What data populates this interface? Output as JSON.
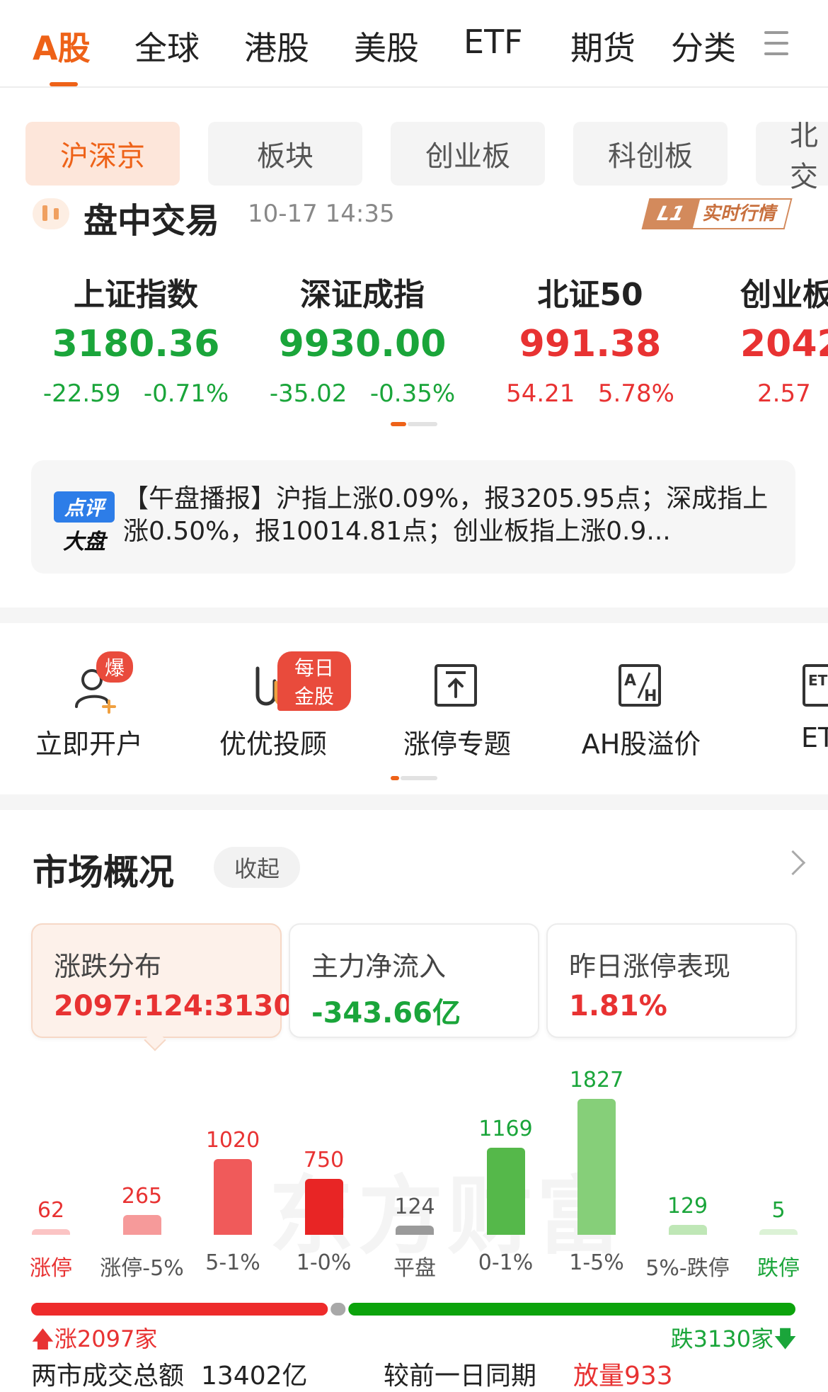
{
  "top_tabs": [
    "A股",
    "全球",
    "港股",
    "美股",
    "ETF",
    "期货",
    "分类"
  ],
  "sub_tabs": [
    "沪深京",
    "板块",
    "创业板",
    "科创板",
    "北交"
  ],
  "trade": {
    "title": "盘中交易",
    "time": "10-17 14:35",
    "badge_left": "L1",
    "badge_right": "实时行情"
  },
  "indices": [
    {
      "name": "上证指数",
      "value": "3180.36",
      "change": "-22.59",
      "pct": "-0.71%",
      "trend": "down"
    },
    {
      "name": "深证成指",
      "value": "9930.00",
      "change": "-35.02",
      "pct": "-0.35%",
      "trend": "down"
    },
    {
      "name": "北证50",
      "value": "991.38",
      "change": "54.21",
      "pct": "5.78%",
      "trend": "up"
    },
    {
      "name": "创业板",
      "value": "2042",
      "change": "2.57",
      "pct": "",
      "trend": "up"
    }
  ],
  "news": {
    "logo_top": "点评",
    "logo_bottom": "大盘",
    "text": "【午盘播报】沪指上涨0.09%，报3205.95点；深成指上涨0.50%，报10014.81点；创业板指上涨0.9..."
  },
  "shortcuts": [
    {
      "label": "立即开户",
      "badge": "爆"
    },
    {
      "label": "优优投顾",
      "badge": "每日金股"
    },
    {
      "label": "涨停专题",
      "badge": ""
    },
    {
      "label": "AH股溢价",
      "badge": ""
    },
    {
      "label": "ET",
      "badge": ""
    }
  ],
  "market": {
    "title": "市场概况",
    "collapse": "收起",
    "cards": [
      {
        "title": "涨跌分布",
        "value": "2097:124:3130",
        "color": "#e83232"
      },
      {
        "title": "主力净流入",
        "value": "-343.66亿",
        "color": "#1aa53a"
      },
      {
        "title": "昨日涨停表现",
        "value": "1.81%",
        "color": "#e83232"
      }
    ],
    "watermark": "东方财富"
  },
  "chart_data": {
    "type": "bar",
    "categories": [
      "涨停",
      "涨停-5%",
      "5-1%",
      "1-0%",
      "平盘",
      "0-1%",
      "1-5%",
      "5%-跌停",
      "跌停"
    ],
    "values": [
      62,
      265,
      1020,
      750,
      124,
      1169,
      1827,
      129,
      5
    ],
    "colors": [
      "#fbc4c4",
      "#f69a9a",
      "#f05a5a",
      "#e82525",
      "#9a9a9a",
      "#55b84a",
      "#86cf79",
      "#bfe7b6",
      "#dcf2d6"
    ],
    "label_colors": [
      "#e83232",
      "#e83232",
      "#e83232",
      "#e83232",
      "#555555",
      "#1aa53a",
      "#1aa53a",
      "#1aa53a",
      "#1aa53a"
    ],
    "category_colors": [
      "#e83232",
      "#555555",
      "#555555",
      "#555555",
      "#555555",
      "#555555",
      "#555555",
      "#555555",
      "#1aa53a"
    ]
  },
  "ratio": {
    "up": 2097,
    "flat": 124,
    "down": 3130,
    "up_label": "涨2097家",
    "down_label": "跌3130家"
  },
  "footer": {
    "turnover_label": "两市成交总额",
    "turnover_value": "13402亿",
    "compare_label": "较前一日同期",
    "compare_value": "放量933"
  }
}
